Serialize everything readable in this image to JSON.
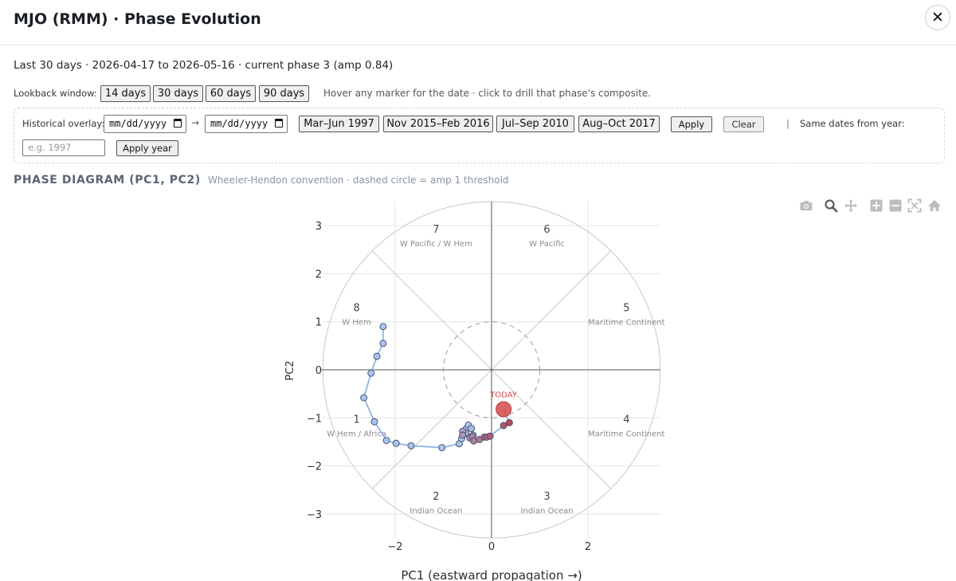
{
  "header": {
    "title": "MJO (RMM) · Phase Evolution",
    "close_label": "✕"
  },
  "summary": "Last 30 days · 2026-04-17 to 2026-05-16 · current phase 3 (amp 0.84)",
  "lookback": {
    "label": "Lookback window:",
    "buttons": [
      "14 days",
      "30 days",
      "60 days",
      "90 days"
    ],
    "hint": "Hover any marker for the date · click to drill that phase's composite."
  },
  "overlay": {
    "label": "Historical overlay:",
    "date_placeholder": "mm/dd/yyyy",
    "arrow": "→",
    "presets": [
      "Mar–Jun 1997",
      "Nov 2015–Feb 2016",
      "Jul–Sep 2010",
      "Aug–Oct 2017"
    ],
    "apply_label": "Apply",
    "clear_label": "Clear",
    "separator": "|",
    "same_dates_label": "Same dates from year:",
    "year_placeholder": "e.g. 1997",
    "apply_year_label": "Apply year"
  },
  "chart_heading": {
    "title": "PHASE DIAGRAM (PC1, PC2)",
    "subtitle": "Wheeler-Hendon convention · dashed circle = amp 1 threshold"
  },
  "modebar_icons": [
    "camera-icon",
    "zoom-icon",
    "pan-icon",
    "zoom-in-icon",
    "zoom-out-icon",
    "autoscale-icon",
    "reset-icon"
  ],
  "colors": {
    "trajectory_line": "#8fb3e6",
    "early_marker": "#a9c4ee",
    "late_marker": "#b24a5f",
    "today": "#d24a4a",
    "grid": "#e6e6e6",
    "guide": "#c9c9c9"
  },
  "chart_data": {
    "type": "scatter",
    "xlabel": "PC1 (eastward propagation →)",
    "ylabel": "PC2",
    "xlim": [
      -3.5,
      3.5
    ],
    "ylim": [
      -3.5,
      3.5
    ],
    "xticks": [
      -2,
      0,
      2
    ],
    "yticks": [
      -3,
      -2,
      -1,
      0,
      1,
      2,
      3
    ],
    "grid": true,
    "phases": [
      {
        "num": "1",
        "region": "W Hem / Africa",
        "x": -2.8,
        "y": -1.1
      },
      {
        "num": "2",
        "region": "Indian Ocean",
        "x": -1.15,
        "y": -2.7
      },
      {
        "num": "3",
        "region": "Indian Ocean",
        "x": 1.15,
        "y": -2.7
      },
      {
        "num": "4",
        "region": "Maritime Continent",
        "x": 2.8,
        "y": -1.1
      },
      {
        "num": "5",
        "region": "Maritime Continent",
        "x": 2.8,
        "y": 1.22
      },
      {
        "num": "6",
        "region": "W Pacific",
        "x": 1.15,
        "y": 2.85
      },
      {
        "num": "7",
        "region": "W Pacific / W Hem",
        "x": -1.15,
        "y": 2.85
      },
      {
        "num": "8",
        "region": "W Hem",
        "x": -2.8,
        "y": 1.22
      }
    ],
    "trajectory": {
      "x": [
        -2.25,
        -2.25,
        -2.38,
        -2.5,
        -2.65,
        -2.43,
        -2.18,
        -1.98,
        -1.67,
        -1.03,
        -0.67,
        -0.62,
        -0.58,
        -0.52,
        -0.48,
        -0.42,
        -0.38,
        -0.53,
        -0.6,
        -0.6,
        -0.45,
        -0.4,
        -0.37,
        -0.25,
        -0.15,
        -0.1,
        -0.03,
        0.25,
        0.37,
        0.25
      ],
      "y": [
        0.9,
        0.55,
        0.28,
        -0.07,
        -0.58,
        -1.08,
        -1.47,
        -1.53,
        -1.58,
        -1.62,
        -1.54,
        -1.43,
        -1.32,
        -1.22,
        -1.15,
        -1.22,
        -1.36,
        -1.32,
        -1.28,
        -1.36,
        -1.42,
        -1.39,
        -1.48,
        -1.45,
        -1.4,
        -1.4,
        -1.38,
        -1.16,
        -1.1,
        -0.82
      ]
    },
    "today": {
      "label": "TODAY",
      "x": 0.25,
      "y": -0.82,
      "amp": 0.84,
      "phase": 3
    },
    "amp1_threshold": 1,
    "outer_radius": 3.5
  }
}
